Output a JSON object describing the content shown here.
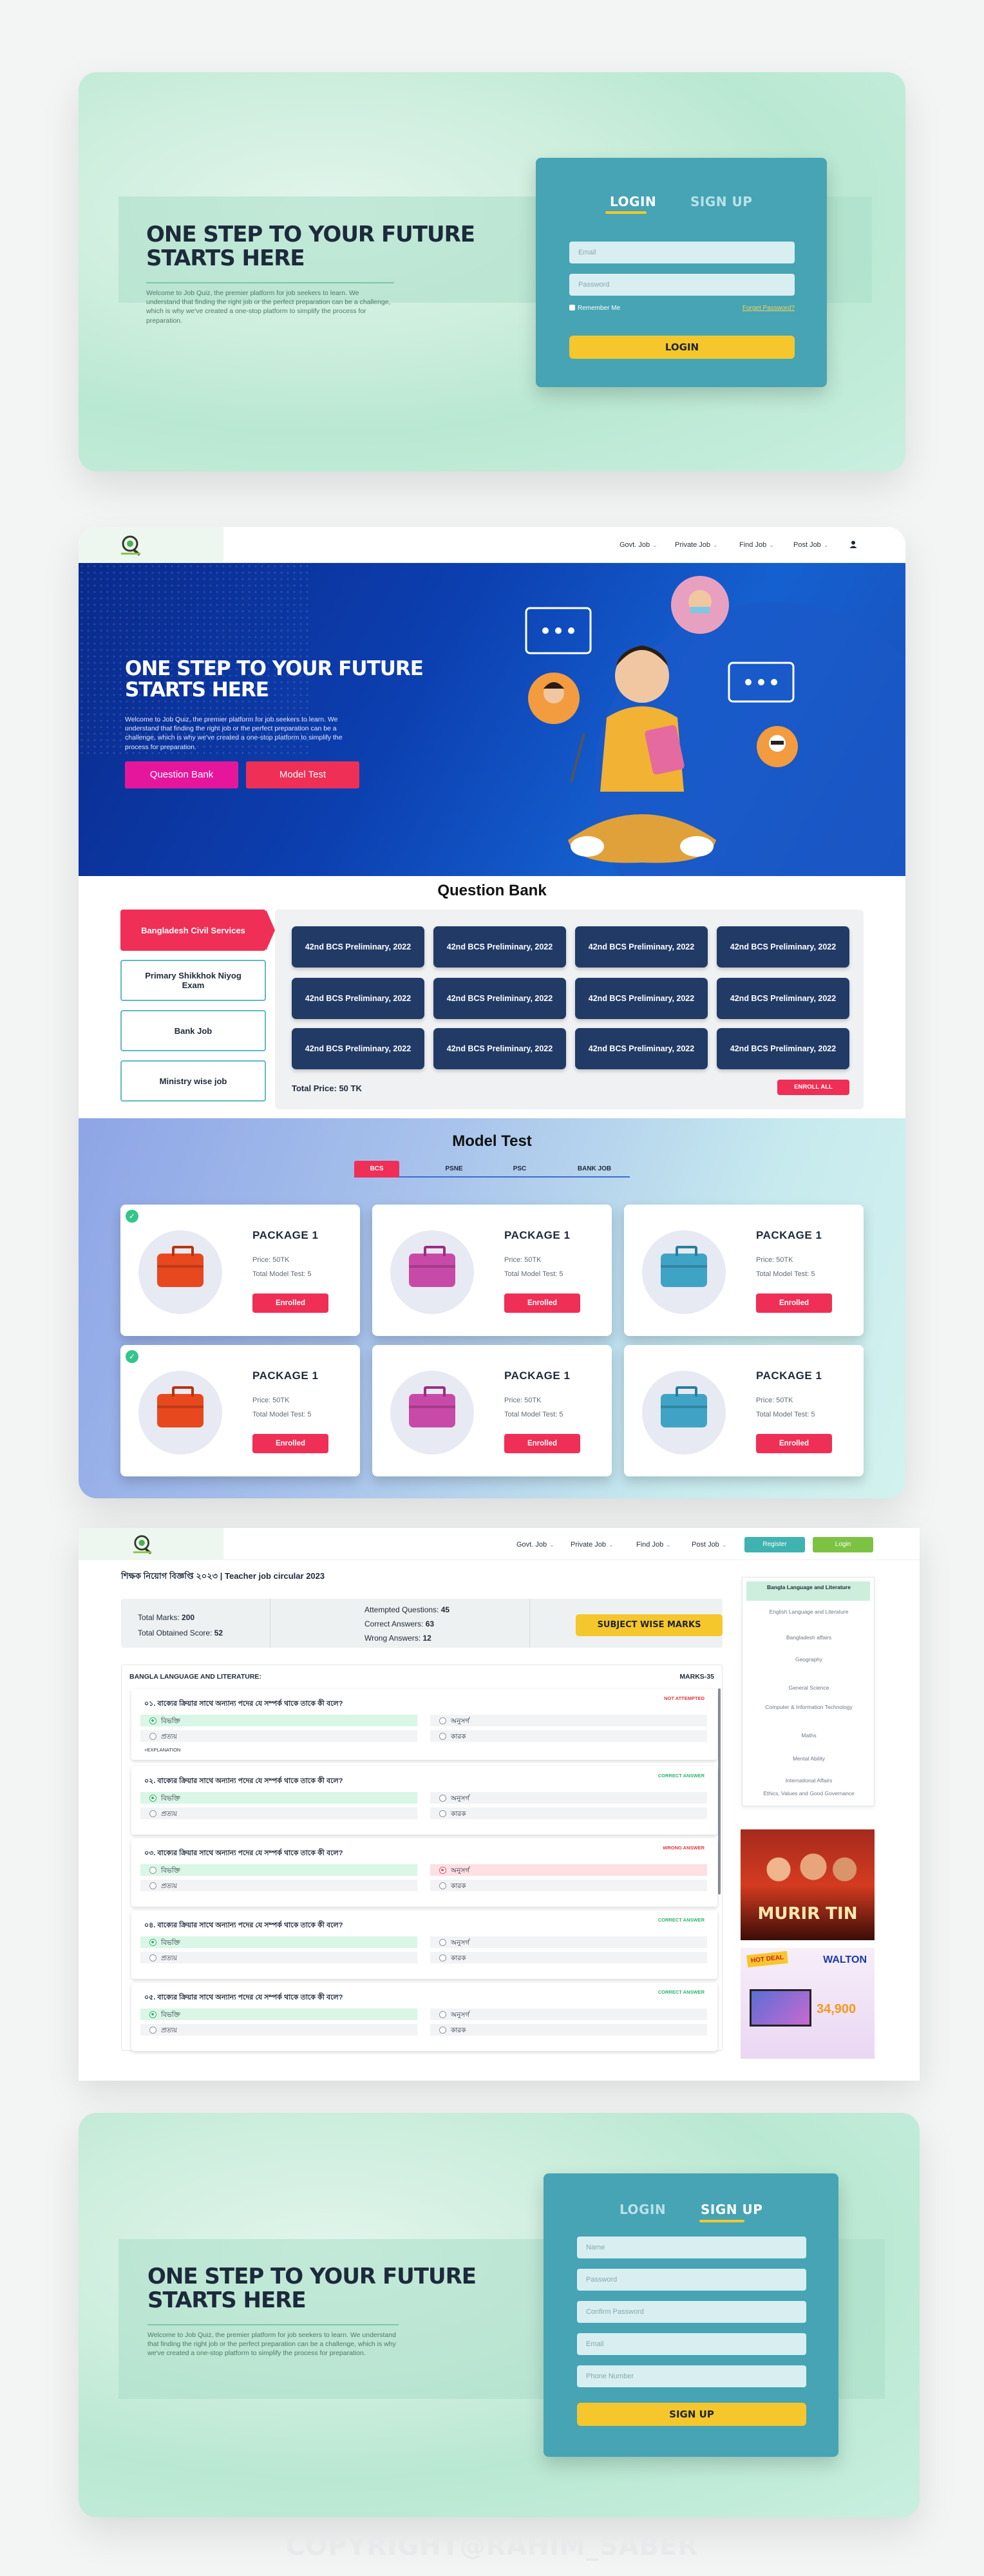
{
  "hero": {
    "title_line1": "ONE STEP TO YOUR FUTURE",
    "title_line2": "STARTS HERE",
    "text": "Welcome to Job Quiz, the premier platform for job seekers to learn. We understand that finding the right job or the perfect preparation can be a challenge, which is why we've created a one-stop platform to simplify the process for preparation."
  },
  "login_form": {
    "tab_login": "LOGIN",
    "tab_signup": "SIGN UP",
    "email_placeholder": "Email",
    "password_placeholder": "Password",
    "remember_me": "Remember Me",
    "forgot_password": "Forget Password?",
    "submit": "LOGIN"
  },
  "nav": {
    "items": [
      "Govt. Job",
      "Private Job",
      "Find Job",
      "Post Job"
    ],
    "register": "Register",
    "login": "Login"
  },
  "banner": {
    "title_line1": "ONE STEP TO YOUR FUTURE",
    "title_line2": "STARTS HERE",
    "text": "Welcome to Job Quiz, the premier platform for job seekers to learn. We understand that finding the right job or the perfect preparation can be a challenge, which is why we've created a one-stop platform to simplify the process for preparation.",
    "btn_question_bank": "Question Bank",
    "btn_model_test": "Model Test"
  },
  "question_bank": {
    "title": "Question Bank",
    "categories": [
      "Bangladesh Civil Services",
      "Primary Shikkhok Niyog Exam",
      "Bank Job",
      "Ministry wise job"
    ],
    "items": [
      "42nd BCS Preliminary, 2022",
      "42nd BCS Preliminary, 2022",
      "42nd BCS Preliminary, 2022",
      "42nd BCS Preliminary, 2022",
      "42nd BCS Preliminary, 2022",
      "42nd BCS Preliminary, 2022",
      "42nd BCS Preliminary, 2022",
      "42nd BCS Preliminary, 2022",
      "42nd BCS Preliminary, 2022",
      "42nd BCS Preliminary, 2022",
      "42nd BCS Preliminary, 2022",
      "42nd BCS Preliminary, 2022"
    ],
    "total_price": "Total Price: 50 TK",
    "enroll_all": "ENROLL ALL"
  },
  "model_test": {
    "title": "Model Test",
    "tabs": [
      "BCS",
      "PSNE",
      "PSC",
      "BANK JOB"
    ],
    "packages": [
      {
        "name": "PACKAGE 1",
        "price": "Price: 50TK",
        "total": "Total Model Test: 5",
        "button": "Enrolled",
        "color": "#e8481e"
      },
      {
        "name": "PACKAGE 1",
        "price": "Price: 50TK",
        "total": "Total Model Test: 5",
        "button": "Enrolled",
        "color": "#c84aa8"
      },
      {
        "name": "PACKAGE 1",
        "price": "Price: 50TK",
        "total": "Total Model Test: 5",
        "button": "Enrolled",
        "color": "#3fa3c6"
      },
      {
        "name": "PACKAGE 1",
        "price": "Price: 50TK",
        "total": "Total Model Test: 5",
        "button": "Enrolled",
        "color": "#e8481e"
      },
      {
        "name": "PACKAGE 1",
        "price": "Price: 50TK",
        "total": "Total Model Test: 5",
        "button": "Enrolled",
        "color": "#c84aa8"
      },
      {
        "name": "PACKAGE 1",
        "price": "Price: 50TK",
        "total": "Total Model Test: 5",
        "button": "Enrolled",
        "color": "#3fa3c6"
      }
    ]
  },
  "exam": {
    "title": "শিক্ষক নিয়োগ বিজ্ঞপ্তি ২০২৩ | Teacher job circular 2023",
    "total_marks_label": "Total Marks:",
    "total_marks": "200",
    "obtained_label": "Total Obtained Score:",
    "obtained": "52",
    "attempted_label": "Attempted Questions:",
    "attempted": "45",
    "correct_label": "Correct Answers:",
    "correct": "63",
    "wrong_label": "Wrong Answers:",
    "wrong": "12",
    "subject_btn": "SUBJECT WISE MARKS",
    "section_label": "BANGLA LANGUAGE AND LITERATURE:",
    "section_marks": "MARKS-35",
    "questions": [
      {
        "q": "০১. বাক্যের ক্রিয়ার সাথে অন্যান্য পদের যে সম্পর্ক থাকে তাকে কী বলে?",
        "status": "NOT ATTEMPTED",
        "opts": [
          "বিভক্তি",
          "অনুসর্গ",
          "প্রত্যয়",
          "কারক"
        ],
        "explanation": "EXPLANATION"
      },
      {
        "q": "০২. বাক্যের ক্রিয়ার সাথে অন্যান্য পদের যে সম্পর্ক থাকে তাকে কী বলে?",
        "status": "CORRECT ANSWER",
        "opts": [
          "বিভক্তি",
          "অনুসর্গ",
          "প্রত্যয়",
          "কারক"
        ]
      },
      {
        "q": "০৩. বাক্যের ক্রিয়ার সাথে অন্যান্য পদের যে সম্পর্ক থাকে তাকে কী বলে?",
        "status": "WRONG ANSWER",
        "opts": [
          "বিভক্তি",
          "অনুসর্গ",
          "প্রত্যয়",
          "কারক"
        ]
      },
      {
        "q": "০৪. বাক্যের ক্রিয়ার সাথে অন্যান্য পদের যে সম্পর্ক থাকে তাকে কী বলে?",
        "status": "CORRECT ANSWER",
        "opts": [
          "বিভক্তি",
          "অনুসর্গ",
          "প্রত্যয়",
          "কারক"
        ]
      },
      {
        "q": "০৫. বাক্যের ক্রিয়ার সাথে অন্যান্য পদের যে সম্পর্ক থাকে তাকে কী বলে?",
        "status": "CORRECT ANSWER",
        "opts": [
          "বিভক্তি",
          "অনুসর্গ",
          "প্রত্যয়",
          "কারক"
        ]
      }
    ],
    "subjects": [
      "Bangla Language and Literature",
      "English Language and Literature",
      "Bangladesh affairs",
      "Geography",
      "General Science",
      "Computer & Information Technology",
      "Maths",
      "Mental Ability",
      "International Affairs",
      "Ethics, Values and Good Governance"
    ],
    "ad1": "MURIR TIN",
    "ad2_brand": "WALTON",
    "ad2_price": "34,900",
    "ad2_badge": "HOT DEAL"
  },
  "signup_form": {
    "tab_login": "LOGIN",
    "tab_signup": "SIGN UP",
    "name_placeholder": "Name",
    "password_placeholder": "Password",
    "confirm_placeholder": "Confirm Password",
    "email_placeholder": "Email",
    "phone_placeholder": "Phone Number",
    "submit": "SIGN UP"
  },
  "copyright": "COPYRIGHT@RAHIM_SABER"
}
